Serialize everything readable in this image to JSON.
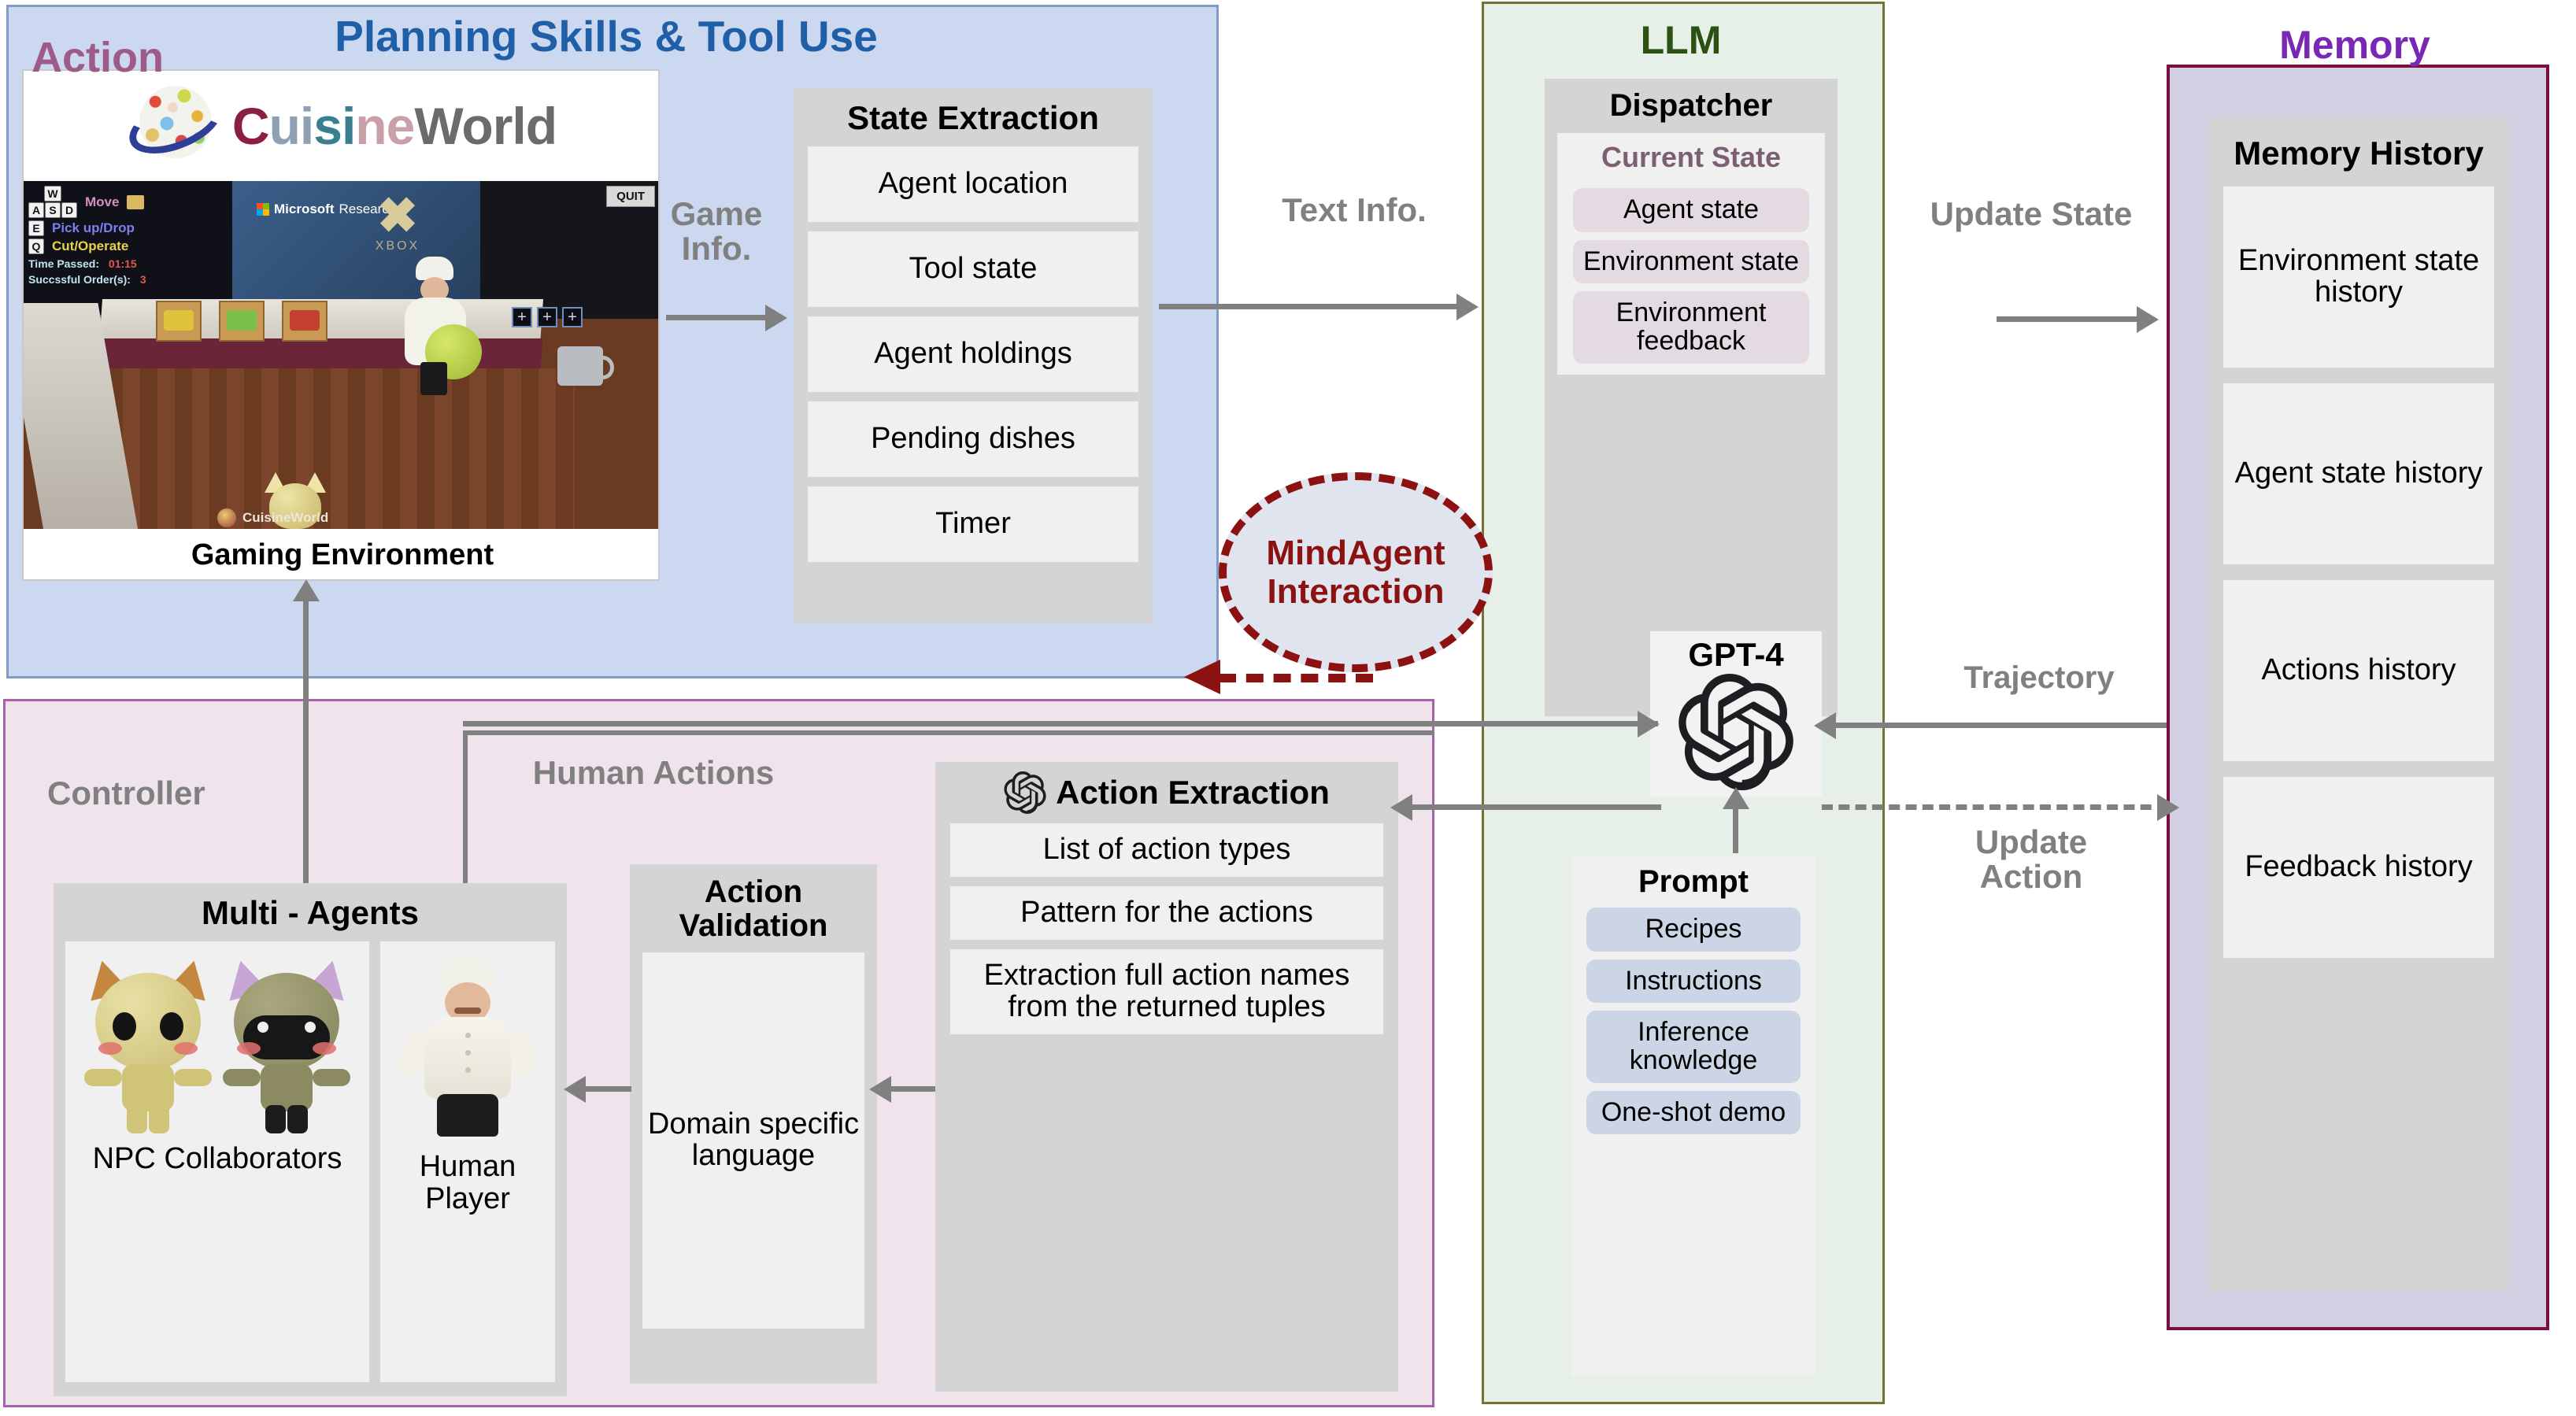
{
  "panels": {
    "planning": {
      "title": "Planning Skills & Tool Use"
    },
    "llm": {
      "title": "LLM"
    },
    "memory": {
      "title": "Memory"
    },
    "action": {
      "title": "Action"
    }
  },
  "game": {
    "logo": {
      "part1": "C",
      "part2": "ui",
      "part3": "si",
      "part4": "ne",
      "part5": "World"
    },
    "caption": "Gaming Environment",
    "brand_watermark": "CuisineWorld",
    "quit_button": "QUIT",
    "ms_logo": "Microsoft",
    "ms_logo_light": "Research",
    "xbox_mark": "✖",
    "xbox_text": "XBOX",
    "hud": {
      "keys_wasd": {
        "w": "W",
        "a": "A",
        "s": "S",
        "d": "D"
      },
      "move_label": "Move",
      "key_e": "E",
      "pick_label": "Pick up/Drop",
      "key_q": "Q",
      "cut_label": "Cut/Operate",
      "time_label": "Time Passed:",
      "time_value": "01:15",
      "orders_label": "Succssful Order(s):",
      "orders_value": "3"
    }
  },
  "state_extraction": {
    "title": "State Extraction",
    "items": [
      {
        "label": "Agent location"
      },
      {
        "label": "Tool state"
      },
      {
        "label": "Agent holdings"
      },
      {
        "label": "Pending dishes"
      },
      {
        "label": "Timer"
      }
    ]
  },
  "dispatcher": {
    "title": "Dispatcher",
    "current_state_title": "Current State",
    "items": [
      {
        "label": "Agent state"
      },
      {
        "label": "Environment state"
      },
      {
        "label": "Environment feedback"
      }
    ]
  },
  "gpt": {
    "title": "GPT-4"
  },
  "prompt": {
    "title": "Prompt",
    "items": [
      {
        "label": "Recipes"
      },
      {
        "label": "Instructions"
      },
      {
        "label": "Inference knowledge"
      },
      {
        "label": "One-shot demo"
      }
    ]
  },
  "memory": {
    "history_title": "Memory History",
    "items": [
      {
        "label": "Environment state history"
      },
      {
        "label": "Agent state history"
      },
      {
        "label": "Actions history"
      },
      {
        "label": "Feedback history"
      }
    ]
  },
  "action_extraction": {
    "title": "Action Extraction",
    "items": [
      {
        "label": "List of action types"
      },
      {
        "label": "Pattern for the actions"
      },
      {
        "label": "Extraction full action names from the returned tuples"
      }
    ]
  },
  "action_validation": {
    "title": "Action Validation",
    "items": [
      {
        "label": "Domain specific language"
      }
    ]
  },
  "multi_agents": {
    "title": "Multi - Agents",
    "npc_caption": "NPC Collaborators",
    "human_caption": "Human Player"
  },
  "labels": {
    "game_info": "Game Info.",
    "text_info": "Text Info.",
    "update_state": "Update State",
    "trajectory": "Trajectory",
    "update_action": "Update Action",
    "controller": "Controller",
    "human_actions": "Human Actions",
    "mindagent": "MindAgent Interaction"
  },
  "colors": {
    "planning_border": "#7f9cc4",
    "planning_fill": "#ccd8ef",
    "planning_title": "#1f5fa8",
    "llm_border": "#747335",
    "llm_fill": "#e7efe9",
    "llm_title": "#2b5212",
    "memory_border": "#7c0d3e",
    "memory_fill": "#d2d0e2",
    "memory_title": "#7927b5",
    "action_border": "#a862ab",
    "action_fill": "#efe3ec",
    "action_title": "#9e5a8a",
    "mindagent": "#8c1111",
    "arrow": "#808080",
    "cell": "#f0f0f0",
    "stack": "#d4d4d4"
  }
}
